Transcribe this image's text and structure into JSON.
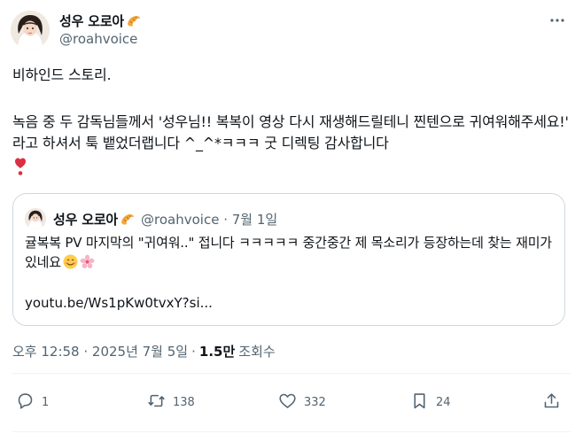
{
  "tweet": {
    "author": {
      "display_name": "성우 오로아",
      "handle": "@roahvoice",
      "name_emoji": "croissant-icon"
    },
    "text_line1": "비하인드 스토리.",
    "text_para2": "녹음 중 두 감독님들께서 '성우님!! 복복이 영상 다시 재생해드릴테니 찐텐으로 귀여워해주세요!' 라고 하셔서 툭 뱉었더랩니다 ^_^*ㅋㅋㅋ 굿 디렉팅 감사합니다",
    "trailing_emoji": "heart-exclamation-icon",
    "timestamp": "오후 12:58 · 2025년 7월 5일",
    "views_count": "1.5만",
    "views_label": "조회수",
    "separator": "·"
  },
  "quote": {
    "display_name": "성우 오로아",
    "meta": "@roahvoice · 7월 1일",
    "text": "귤복복 PV 마지막의 \"귀여워..\" 접니다 ㅋㅋㅋㅋㅋ 중간중간 제 목소리가 등장하는데 찾는 재미가 있네요",
    "emojis": [
      "smiling-face-icon",
      "cherry-blossom-icon"
    ],
    "link": "youtu.be/Ws1pKw0tvxY?si..."
  },
  "actions": {
    "reply_count": "1",
    "retweet_count": "138",
    "like_count": "332",
    "bookmark_count": "24"
  },
  "colors": {
    "text": "#0f1419",
    "secondary": "#536471",
    "border": "#cfd9de",
    "heart": "#dd2e44"
  }
}
